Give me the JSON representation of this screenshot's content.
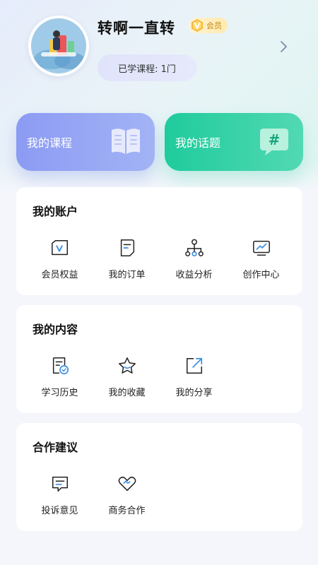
{
  "profile": {
    "username": "转啊一直转",
    "vip_label": "会员",
    "courses_learned": "已学课程: 1门"
  },
  "cards": {
    "my_courses": "我的课程",
    "my_topics": "我的话题"
  },
  "sections": {
    "account": {
      "title": "我的账户",
      "items": [
        {
          "label": "会员权益",
          "icon": "vip-card-icon"
        },
        {
          "label": "我的订单",
          "icon": "order-icon"
        },
        {
          "label": "收益分析",
          "icon": "hierarchy-icon"
        },
        {
          "label": "创作中心",
          "icon": "monitor-chart-icon"
        }
      ]
    },
    "content": {
      "title": "我的内容",
      "items": [
        {
          "label": "学习历史",
          "icon": "history-icon"
        },
        {
          "label": "我的收藏",
          "icon": "star-icon"
        },
        {
          "label": "我的分享",
          "icon": "share-icon"
        }
      ]
    },
    "cooperation": {
      "title": "合作建议",
      "items": [
        {
          "label": "投诉意见",
          "icon": "feedback-icon"
        },
        {
          "label": "商务合作",
          "icon": "handshake-icon"
        }
      ]
    }
  },
  "colors": {
    "course_card": "#8c9bf3",
    "topic_card": "#1fcb9c",
    "icon_accent": "#3a8ee6",
    "vip_gold": "#e9a425"
  }
}
